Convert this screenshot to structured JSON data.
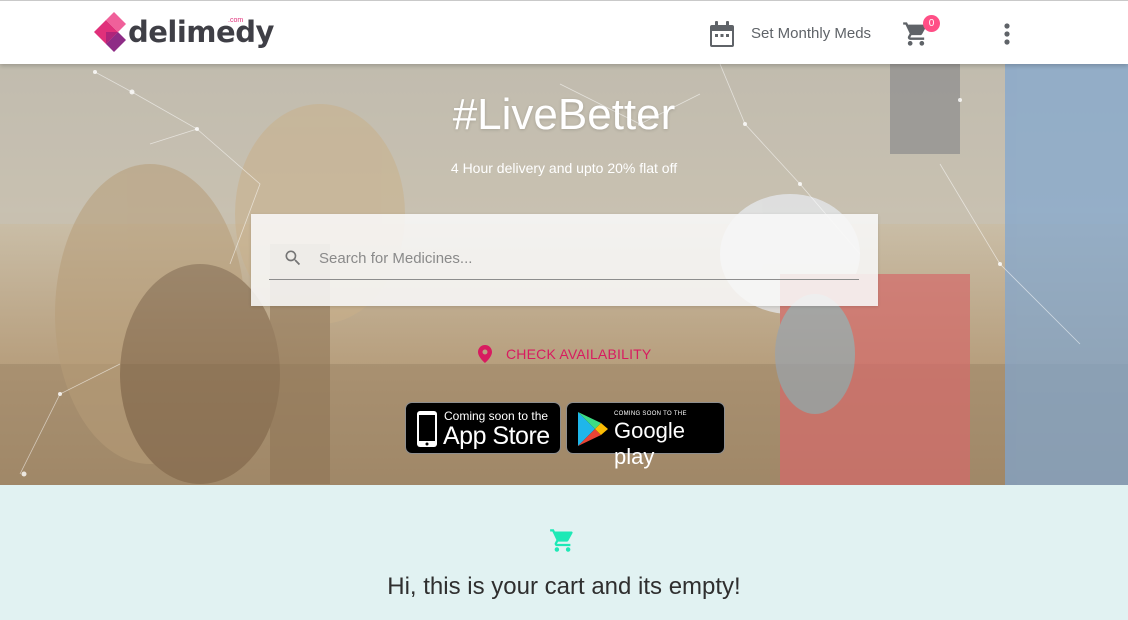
{
  "header": {
    "logo_text": "delimedy",
    "logo_suffix": ".com",
    "monthly_meds_label": "Set Monthly Meds",
    "cart_count": "0",
    "icons": [
      "calendar-icon",
      "cart-icon",
      "more-vert-icon"
    ]
  },
  "hero": {
    "title": "#LiveBetter",
    "subtitle": "4 Hour delivery and upto 20% flat off",
    "search": {
      "placeholder": "Search for Medicines...",
      "value": ""
    },
    "check_availability_label": "CHECK AVAILABILITY",
    "app_store": {
      "small": "Coming soon to the",
      "big": "App Store"
    },
    "google_play": {
      "small": "COMING SOON TO THE",
      "big": "Google play"
    }
  },
  "cart": {
    "empty_message": "Hi, this is your cart and its empty!"
  },
  "colors": {
    "brand_pink": "#d81b60",
    "badge_pink": "#ff4f86",
    "cart_teal": "#1de9b6",
    "cart_bg": "#e1f2f2"
  }
}
